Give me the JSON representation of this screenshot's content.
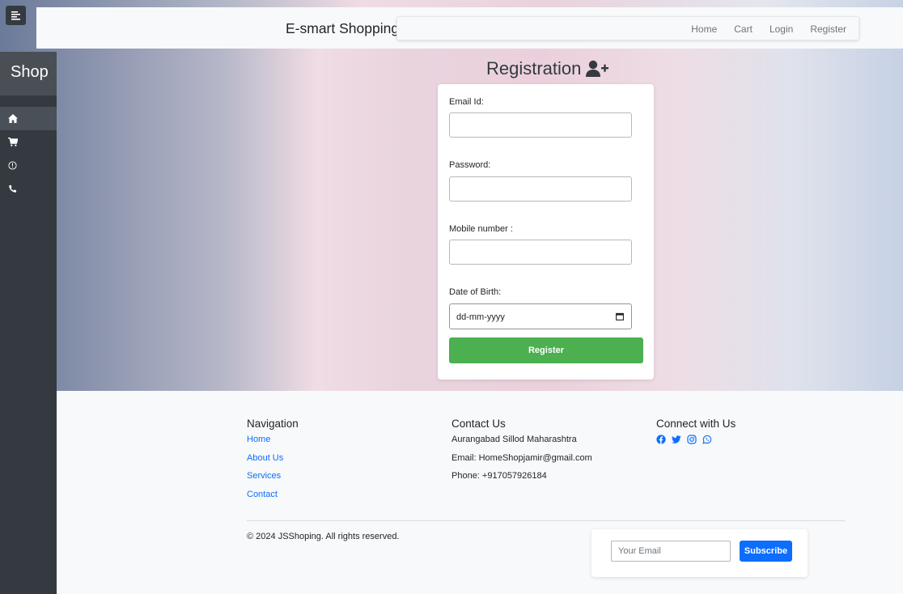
{
  "header": {
    "brand": "E-smart Shopping",
    "nav": [
      "Home",
      "Cart",
      "Login",
      "Register"
    ]
  },
  "sidebar": {
    "brand": "Shop",
    "icons": [
      "home-icon",
      "cart-icon",
      "info-icon",
      "phone-icon"
    ]
  },
  "registration": {
    "title": "Registration",
    "fields": {
      "email_label": "Email Id:",
      "password_label": "Password:",
      "mobile_label": "Mobile number :",
      "dob_label": "Date of Birth:",
      "dob_value": "dd-mm-yyyy"
    },
    "submit_label": "Register",
    "button_color": "#4caf50"
  },
  "footer": {
    "navigation": {
      "heading": "Navigation",
      "links": [
        "Home",
        "About Us",
        "Services",
        "Contact"
      ]
    },
    "contact": {
      "heading": "Contact Us",
      "address": "Aurangabad Sillod Maharashtra",
      "email": "Email: HomeShopjamir@gmail.com",
      "phone": "Phone: +917057926184"
    },
    "connect": {
      "heading": "Connect with Us",
      "icons": [
        "facebook-icon",
        "twitter-icon",
        "instagram-icon",
        "whatsapp-icon"
      ]
    },
    "copyright": "© 2024 JSShoping. All rights reserved.",
    "subscribe": {
      "placeholder": "Your Email",
      "button_label": "Subscribe",
      "button_color": "#0d6efd"
    }
  }
}
